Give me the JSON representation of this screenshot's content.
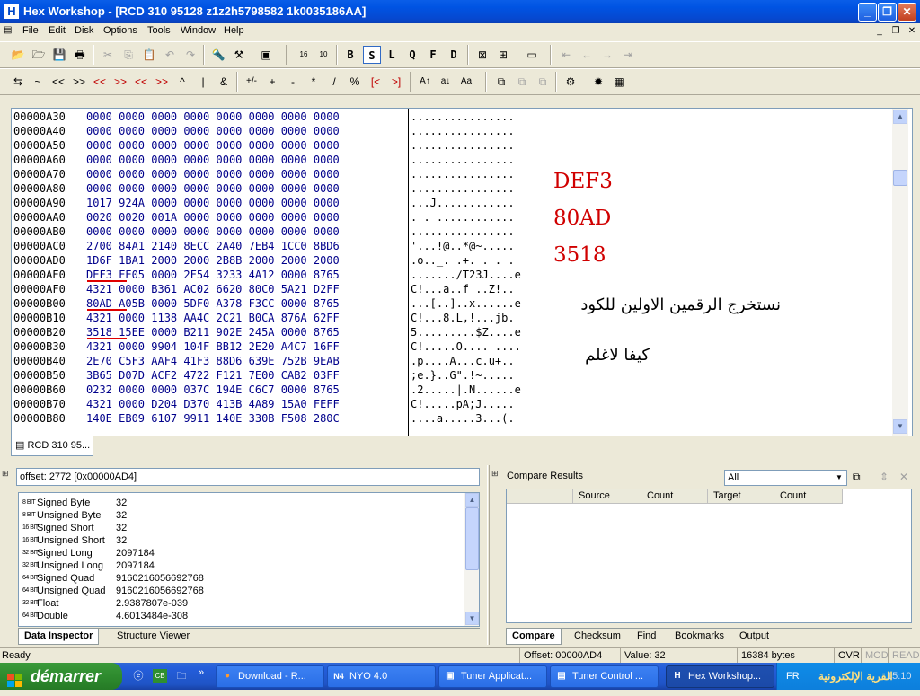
{
  "window": {
    "title": "Hex Workshop - [RCD 310  95128 z1z2h5798582 1k0035186AA]"
  },
  "menu": [
    "File",
    "Edit",
    "Disk",
    "Options",
    "Tools",
    "Window",
    "Help"
  ],
  "toolbar1": {
    "format_buttons": [
      "B",
      "S",
      "L",
      "Q",
      "F",
      "D"
    ]
  },
  "toolbar2": {
    "ops": [
      "⇆",
      "~",
      "<<",
      ">>",
      "<<",
      ">>",
      "<<",
      ">>",
      "^",
      "|",
      "&",
      "+/-",
      "+",
      "-",
      "*",
      "/",
      "%"
    ]
  },
  "hex": {
    "offsets": [
      "00000A30",
      "00000A40",
      "00000A50",
      "00000A60",
      "00000A70",
      "00000A80",
      "00000A90",
      "00000AA0",
      "00000AB0",
      "00000AC0",
      "00000AD0",
      "00000AE0",
      "00000AF0",
      "00000B00",
      "00000B10",
      "00000B20",
      "00000B30",
      "00000B40",
      "00000B50",
      "00000B60",
      "00000B70",
      "00000B80"
    ],
    "rows": [
      "0000 0000 0000 0000 0000 0000 0000 0000",
      "0000 0000 0000 0000 0000 0000 0000 0000",
      "0000 0000 0000 0000 0000 0000 0000 0000",
      "0000 0000 0000 0000 0000 0000 0000 0000",
      "0000 0000 0000 0000 0000 0000 0000 0000",
      "0000 0000 0000 0000 0000 0000 0000 0000",
      "1017 924A 0000 0000 0000 0000 0000 0000",
      "0020 0020 001A 0000 0000 0000 0000 0000",
      "0000 0000 0000 0000 0000 0000 0000 0000",
      "2700 84A1 2140 8ECC 2A40 7EB4 1CC0 8BD6",
      "1D6F 1BA1 2000 2000 2B8B 2000 2000 2000",
      "DEF3 FE05 0000 2F54 3233 4A12 0000 8765",
      "4321 0000 B361 AC02 6620 80C0 5A21 D2FF",
      "80AD A05B 0000 5DF0 A378 F3CC 0000 8765",
      "4321 0000 1138 AA4C 2C21 B0CA 876A 62FF",
      "3518 15EE 0000 B211 902E 245A 0000 8765",
      "4321 0000 9904 104F BB12 2E20 A4C7 16FF",
      "2E70 C5F3 AAF4 41F3 88D6 639E 752B 9EAB",
      "3B65 D07D ACF2 4722 F121 7E00 CAB2 03FF",
      "0232 0000 0000 037C 194E C6C7 0000 8765",
      "4321 0000 D204 D370 413B 4A89 15A0 FEFF",
      "140E EB09 6107 9911 140E 330B F508 280C"
    ],
    "ascii": [
      "................",
      "................",
      "................",
      "................",
      "................",
      "................",
      "...J............",
      ". . ............",
      "................",
      "'...!@..*@~.....",
      ".o.._. .+. . . .",
      ".......∕T23J....e",
      "C!...a..f ..Z!..",
      "...[..]..x......e",
      "C!...8.L,!...jb.",
      "5.........$Z....e",
      "C!.....O.... ....",
      ".p....A...c.u+..",
      ";e.}..G\".!~.....",
      ".2.....|.N......e",
      "C!.....pA;J.....",
      "....a.....3...(."
    ]
  },
  "annotations": {
    "codes": [
      "DEF3",
      "80AD",
      "3518"
    ],
    "arabic_line1": "نستخرج الرقمين الاولين للكود",
    "arabic_line2": "كيفا لاغلم"
  },
  "doc_tab": "RCD 310  95...",
  "inspector": {
    "offset_text": "offset: 2772 [0x00000AD4]",
    "rows": [
      {
        "bits": "8 BIT",
        "label": "Signed Byte",
        "value": "32"
      },
      {
        "bits": "8 BIT",
        "label": "Unsigned Byte",
        "value": "32"
      },
      {
        "bits": "16 BIT",
        "label": "Signed Short",
        "value": "32"
      },
      {
        "bits": "16 BIT",
        "label": "Unsigned Short",
        "value": "32"
      },
      {
        "bits": "32 BIT",
        "label": "Signed Long",
        "value": "2097184"
      },
      {
        "bits": "32 BIT",
        "label": "Unsigned Long",
        "value": "2097184"
      },
      {
        "bits": "64 BIT",
        "label": "Signed Quad",
        "value": "9160216056692768"
      },
      {
        "bits": "64 BIT",
        "label": "Unsigned Quad",
        "value": "9160216056692768"
      },
      {
        "bits": "32 BIT",
        "label": "Float",
        "value": "2.9387807e-039"
      },
      {
        "bits": "64 BIT",
        "label": "Double",
        "value": "4.6013484e-308"
      }
    ],
    "tabs": [
      "Data Inspector",
      "Structure Viewer"
    ]
  },
  "compare": {
    "title": "Compare Results",
    "filter": "All",
    "columns": [
      "Source",
      "Count",
      "Target",
      "Count"
    ],
    "tabs": [
      "Compare",
      "Checksum",
      "Find",
      "Bookmarks",
      "Output"
    ]
  },
  "status": {
    "ready": "Ready",
    "offset": "Offset: 00000AD4",
    "value": "Value: 32",
    "size": "16384 bytes",
    "ovr": "OVR",
    "mod": "MOD",
    "read": "READ"
  },
  "taskbar": {
    "start": "démarrer",
    "tasks": [
      "Download - R...",
      "NYO 4.0",
      "Tuner Applicat...",
      "Tuner Control ...",
      "Hex Workshop..."
    ],
    "lang": "FR",
    "clock": "15:10",
    "watermark": "القرية الإلكترونية"
  },
  "colors": {
    "title_blue": "#0054e3",
    "hex_text": "#00008b",
    "annotation_red": "#d00000",
    "start_green": "#2e8b2e"
  }
}
